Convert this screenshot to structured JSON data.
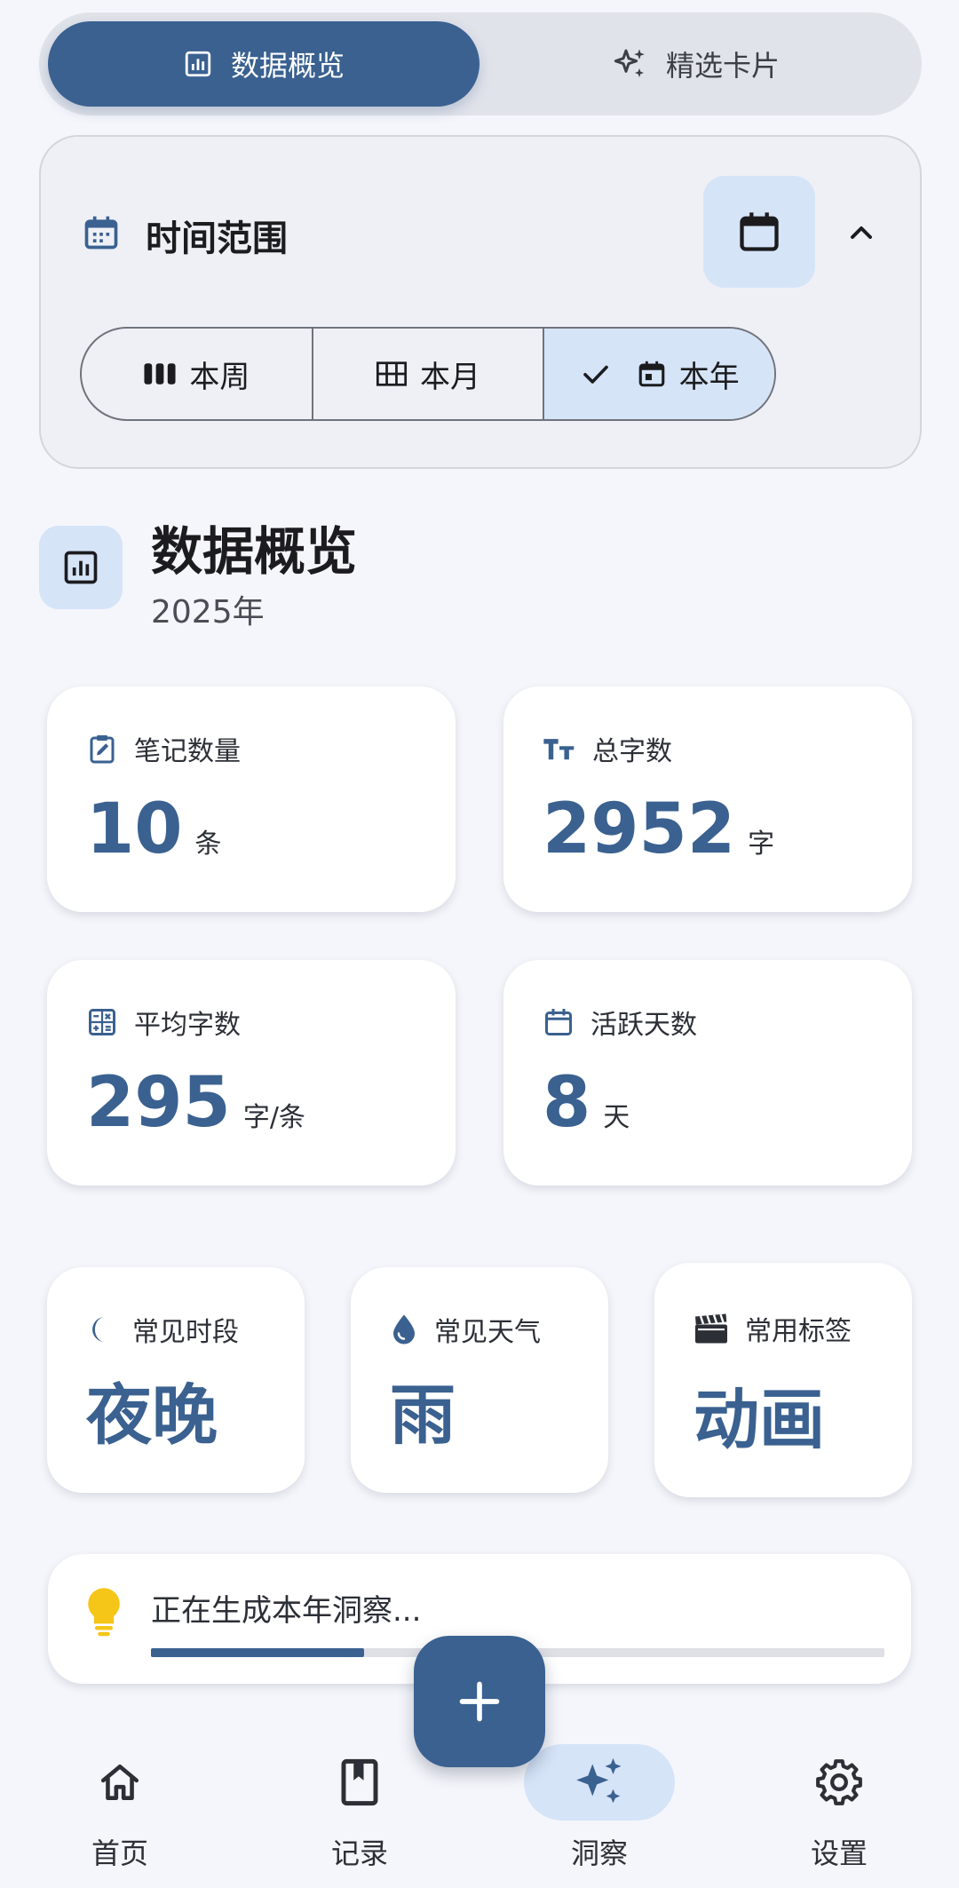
{
  "top_tabs": {
    "overview_label": "数据概览",
    "cards_label": "精选卡片"
  },
  "time_range": {
    "title": "时间范围",
    "options": [
      "本周",
      "本月",
      "本年"
    ],
    "selected": "本年"
  },
  "section": {
    "title": "数据概览",
    "subtitle": "2025年"
  },
  "stats": {
    "notes": {
      "label": "笔记数量",
      "value": "10",
      "unit": "条"
    },
    "words": {
      "label": "总字数",
      "value": "2952",
      "unit": "字"
    },
    "avg": {
      "label": "平均字数",
      "value": "295",
      "unit": "字/条"
    },
    "active_days": {
      "label": "活跃天数",
      "value": "8",
      "unit": "天"
    }
  },
  "habits": {
    "time": {
      "label": "常见时段",
      "value": "夜晚"
    },
    "weather": {
      "label": "常见天气",
      "value": "雨"
    },
    "tag": {
      "label": "常用标签",
      "value": "动画"
    }
  },
  "insight": {
    "text": "正在生成本年洞察...",
    "progress": 0.29
  },
  "nav": {
    "home": "首页",
    "records": "记录",
    "insight": "洞察",
    "settings": "设置",
    "active": "洞察"
  },
  "colors": {
    "accent": "#3a6190",
    "accent_container": "#d6e4f8",
    "background": "#f5f6fb"
  }
}
